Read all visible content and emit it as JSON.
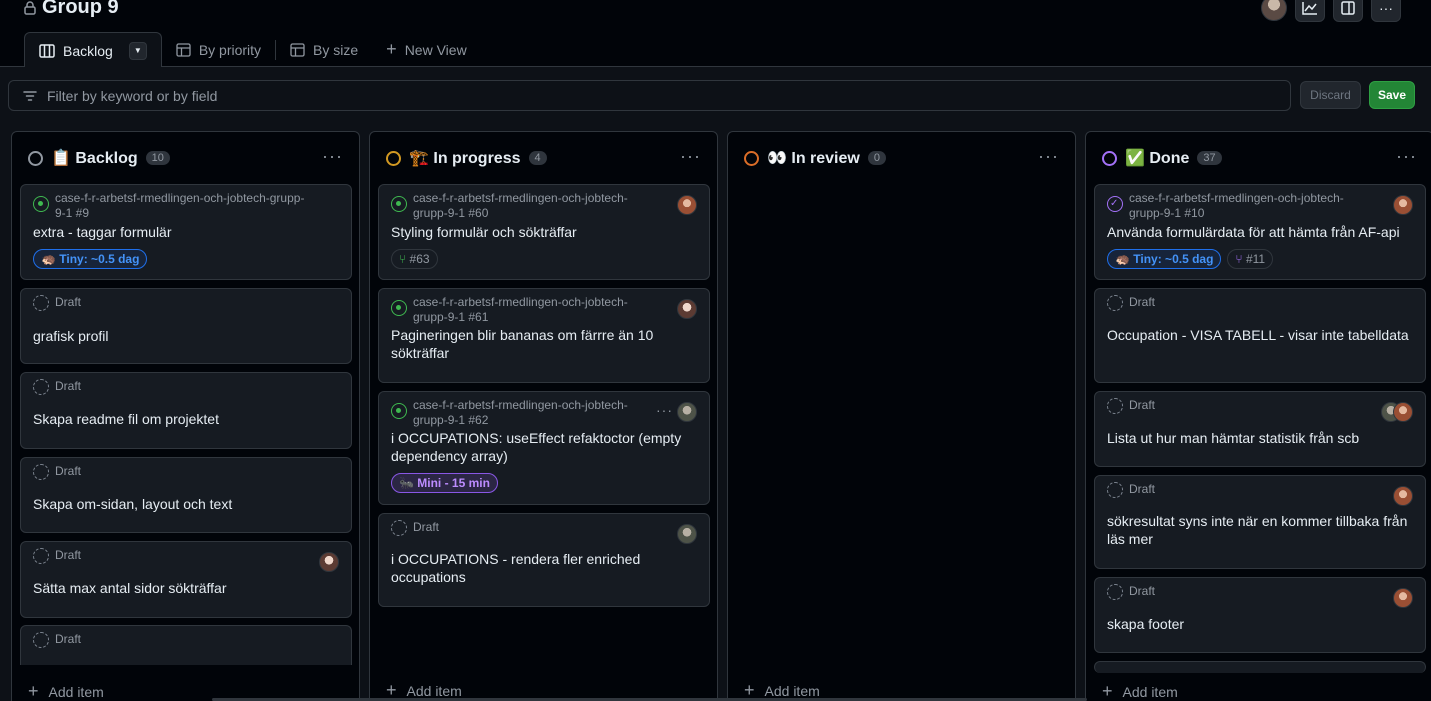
{
  "header": {
    "title": "Group 9"
  },
  "tabs": [
    {
      "label": "Backlog",
      "icon": "board-icon"
    },
    {
      "label": "By priority",
      "icon": "table-icon"
    },
    {
      "label": "By size",
      "icon": "table-icon"
    },
    {
      "label": "New View",
      "icon": "plus-icon"
    }
  ],
  "filter": {
    "placeholder": "Filter by keyword or by field"
  },
  "actions": {
    "discard": "Discard",
    "save": "Save"
  },
  "add_item": "Add item",
  "columns": [
    {
      "title": "📋 Backlog",
      "count": "10",
      "color": "#9198a1",
      "cards": [
        {
          "meta": "case-f-r-arbetsf-rmedlingen-och-jobtech-grupp-9-1 #9",
          "title": "extra - taggar formulär",
          "label": "🦔 Tiny: ~0.5 dag"
        },
        {
          "meta": "Draft",
          "title": "grafisk profil"
        },
        {
          "meta": "Draft",
          "title": "Skapa readme fil om projektet"
        },
        {
          "meta": "Draft",
          "title": "Skapa om-sidan, layout och text"
        },
        {
          "meta": "Draft",
          "title": "Sätta max antal sidor sökträffar"
        },
        {
          "meta": "Draft",
          "title": ""
        }
      ]
    },
    {
      "title": "🏗️ In progress",
      "count": "4",
      "color": "#d29922",
      "cards": [
        {
          "meta": "case-f-r-arbetsf-rmedlingen-och-jobtech-grupp-9-1 #60",
          "title": "Styling formulär och sökträffar",
          "ref": "#63"
        },
        {
          "meta": "case-f-r-arbetsf-rmedlingen-och-jobtech-grupp-9-1 #61",
          "title": "Pagineringen blir bananas om färrre än 10 sökträffar"
        },
        {
          "meta": "case-f-r-arbetsf-rmedlingen-och-jobtech-grupp-9-1 #62",
          "title": "i OCCUPATIONS: useEffect refaktoctor (empty dependency array)",
          "label": "🐜 Mini - 15 min"
        },
        {
          "meta": "Draft",
          "title": "i OCCUPATIONS - rendera fler enriched occupations"
        }
      ]
    },
    {
      "title": "👀 In review",
      "count": "0",
      "color": "#db6d28",
      "cards": []
    },
    {
      "title": "✅ Done",
      "count": "37",
      "color": "#a371f7",
      "cards": [
        {
          "meta": "case-f-r-arbetsf-rmedlingen-och-jobtech-grupp-9-1 #10",
          "title": "Använda formulärdata för att hämta från AF-api",
          "label": "🦔 Tiny: ~0.5 dag",
          "ref": "#11"
        },
        {
          "meta": "Draft",
          "title": "Occupation - VISA TABELL - visar inte tabelldata"
        },
        {
          "meta": "Draft",
          "title": "Lista ut hur man hämtar statistik från scb"
        },
        {
          "meta": "Draft",
          "title": "sökresultat syns inte när en kommer tillbaka från läs mer"
        },
        {
          "meta": "Draft",
          "title": "skapa footer"
        }
      ]
    }
  ]
}
